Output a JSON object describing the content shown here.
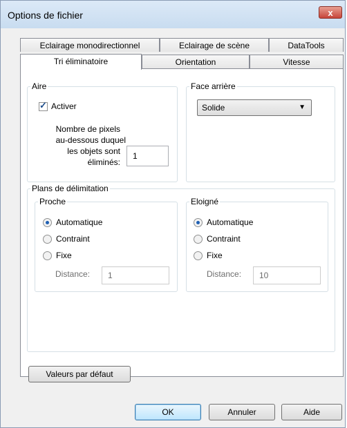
{
  "window": {
    "title": "Options de fichier",
    "close_glyph": "x"
  },
  "tabs_back": [
    "Eclairage monodirectionnel",
    "Eclairage de scène",
    "DataTools"
  ],
  "tabs_front": [
    "Tri éliminatoire",
    "Orientation",
    "Vitesse"
  ],
  "aire": {
    "legend": "Aire",
    "checkbox_label": "Activer",
    "checked": true,
    "pixels_label_1": "Nombre de pixels",
    "pixels_label_2": "au-dessous duquel",
    "pixels_label_3": "les objets sont",
    "pixels_label_4": "éliminés:",
    "pixels_value": "1"
  },
  "face_arriere": {
    "legend": "Face arrière",
    "selected": "Solide"
  },
  "plans": {
    "legend": "Plans de délimitation",
    "proche": {
      "legend": "Proche",
      "options": [
        "Automatique",
        "Contraint",
        "Fixe"
      ],
      "selected": "Automatique",
      "distance_label": "Distance:",
      "distance_value": "1"
    },
    "eloigne": {
      "legend": "Eloigné",
      "options": [
        "Automatique",
        "Contraint",
        "Fixe"
      ],
      "selected": "Automatique",
      "distance_label": "Distance:",
      "distance_value": "10"
    }
  },
  "buttons": {
    "defaults": "Valeurs par défaut",
    "ok": "OK",
    "cancel": "Annuler",
    "help": "Aide"
  }
}
